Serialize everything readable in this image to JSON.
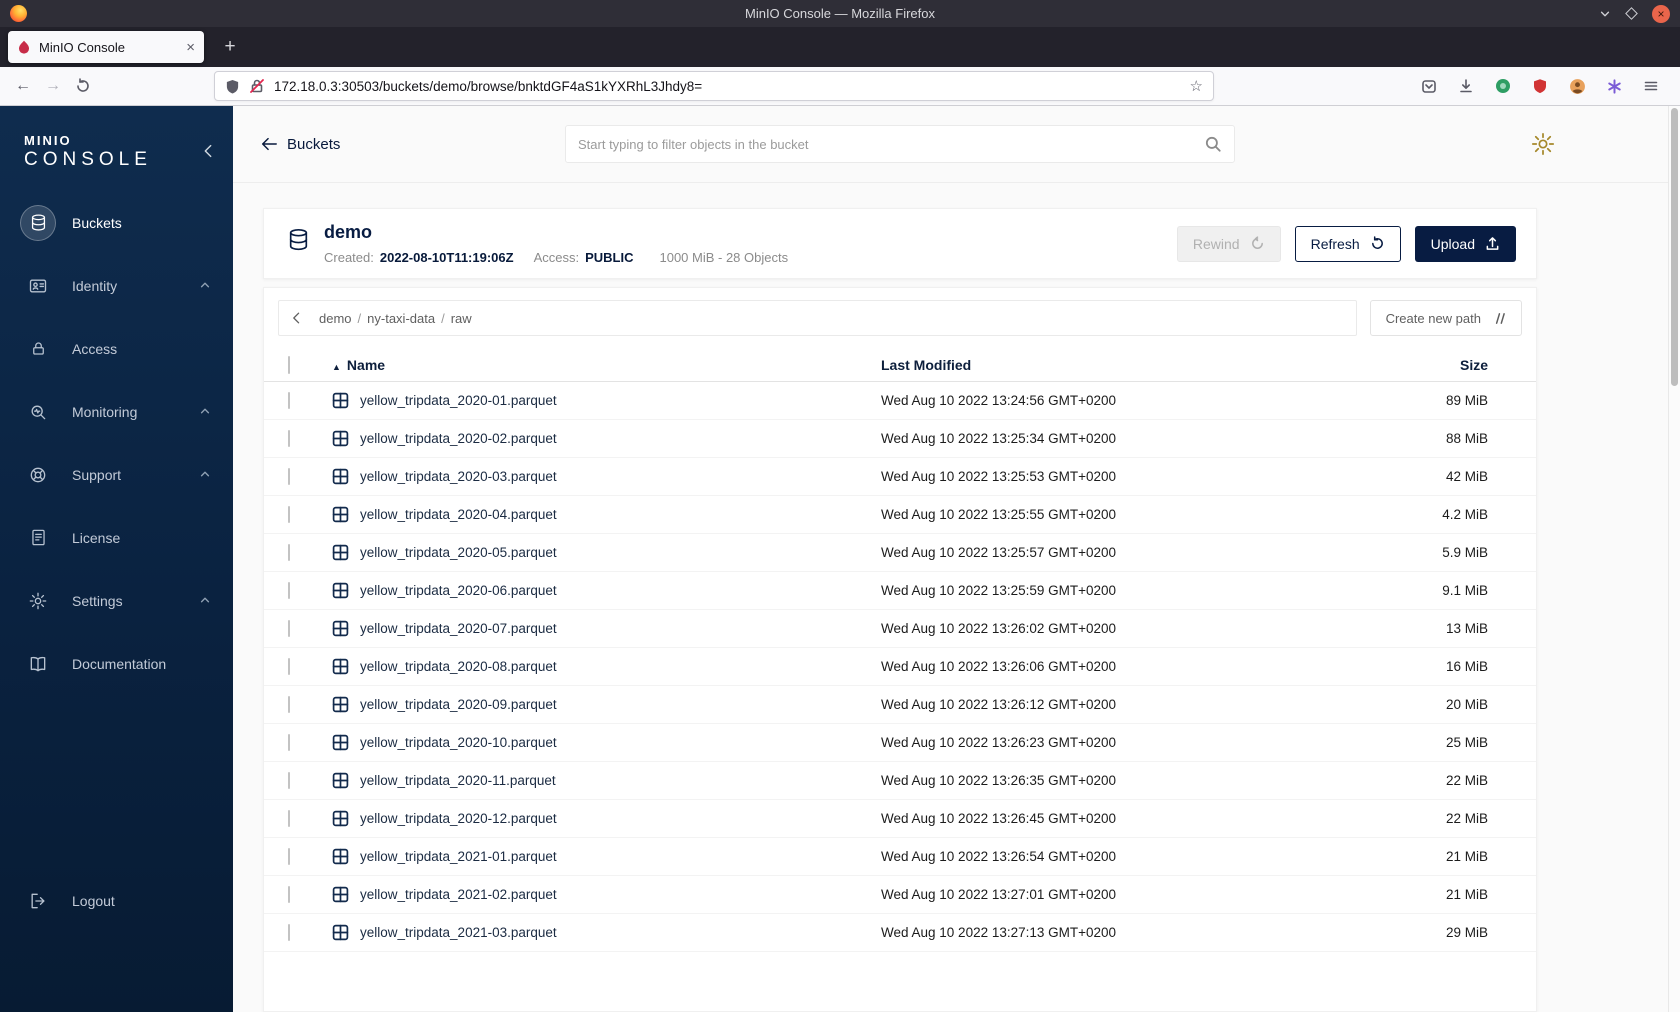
{
  "colors": {
    "brand_navy": "#081c42",
    "sidebar_top": "#0f2c4e",
    "sidebar_bottom": "#071b33",
    "settings_icon_gold": "#a5882a",
    "insecure_red": "#e22850"
  },
  "glyphs": {
    "tab_close": "×",
    "new_tab": "+",
    "nav_back": "←",
    "nav_forward": "→",
    "bookmark_star": "☆",
    "sort_asc": "▲",
    "window_close": "×"
  },
  "browser": {
    "window_title": "MinIO Console — Mozilla Firefox",
    "tab_title": "MinIO Console",
    "url": "172.18.0.3:30503/buckets/demo/browse/bnktdGF4aS1kYXRhL3Jhdy8="
  },
  "sidebar": {
    "brand_top": "MINIO",
    "brand_bottom": "CONSOLE",
    "items": [
      {
        "label": "Buckets",
        "active": true
      },
      {
        "label": "Identity",
        "expandable": true
      },
      {
        "label": "Access"
      },
      {
        "label": "Monitoring",
        "expandable": true
      },
      {
        "label": "Support",
        "expandable": true
      },
      {
        "label": "License"
      },
      {
        "label": "Settings",
        "expandable": true
      },
      {
        "label": "Documentation"
      }
    ],
    "logout_label": "Logout"
  },
  "topbar": {
    "back_label": "Buckets",
    "search_placeholder": "Start typing to filter objects in the bucket"
  },
  "bucket": {
    "name": "demo",
    "created_label": "Created:",
    "created_value": "2022-08-10T11:19:06Z",
    "access_label": "Access:",
    "access_value": "PUBLIC",
    "usage": "1000 MiB - 28 Objects",
    "rewind_label": "Rewind",
    "refresh_label": "Refresh",
    "upload_label": "Upload"
  },
  "browse": {
    "breadcrumb": [
      "demo",
      "ny-taxi-data",
      "raw"
    ],
    "separator": "/",
    "create_path_label": "Create new path"
  },
  "table": {
    "columns": {
      "name": "Name",
      "modified": "Last Modified",
      "size": "Size"
    },
    "rows": [
      {
        "name": "yellow_tripdata_2020-01.parquet",
        "modified": "Wed Aug 10 2022 13:24:56 GMT+0200",
        "size": "89 MiB"
      },
      {
        "name": "yellow_tripdata_2020-02.parquet",
        "modified": "Wed Aug 10 2022 13:25:34 GMT+0200",
        "size": "88 MiB"
      },
      {
        "name": "yellow_tripdata_2020-03.parquet",
        "modified": "Wed Aug 10 2022 13:25:53 GMT+0200",
        "size": "42 MiB"
      },
      {
        "name": "yellow_tripdata_2020-04.parquet",
        "modified": "Wed Aug 10 2022 13:25:55 GMT+0200",
        "size": "4.2 MiB"
      },
      {
        "name": "yellow_tripdata_2020-05.parquet",
        "modified": "Wed Aug 10 2022 13:25:57 GMT+0200",
        "size": "5.9 MiB"
      },
      {
        "name": "yellow_tripdata_2020-06.parquet",
        "modified": "Wed Aug 10 2022 13:25:59 GMT+0200",
        "size": "9.1 MiB"
      },
      {
        "name": "yellow_tripdata_2020-07.parquet",
        "modified": "Wed Aug 10 2022 13:26:02 GMT+0200",
        "size": "13 MiB"
      },
      {
        "name": "yellow_tripdata_2020-08.parquet",
        "modified": "Wed Aug 10 2022 13:26:06 GMT+0200",
        "size": "16 MiB"
      },
      {
        "name": "yellow_tripdata_2020-09.parquet",
        "modified": "Wed Aug 10 2022 13:26:12 GMT+0200",
        "size": "20 MiB"
      },
      {
        "name": "yellow_tripdata_2020-10.parquet",
        "modified": "Wed Aug 10 2022 13:26:23 GMT+0200",
        "size": "25 MiB"
      },
      {
        "name": "yellow_tripdata_2020-11.parquet",
        "modified": "Wed Aug 10 2022 13:26:35 GMT+0200",
        "size": "22 MiB"
      },
      {
        "name": "yellow_tripdata_2020-12.parquet",
        "modified": "Wed Aug 10 2022 13:26:45 GMT+0200",
        "size": "22 MiB"
      },
      {
        "name": "yellow_tripdata_2021-01.parquet",
        "modified": "Wed Aug 10 2022 13:26:54 GMT+0200",
        "size": "21 MiB"
      },
      {
        "name": "yellow_tripdata_2021-02.parquet",
        "modified": "Wed Aug 10 2022 13:27:01 GMT+0200",
        "size": "21 MiB"
      },
      {
        "name": "yellow_tripdata_2021-03.parquet",
        "modified": "Wed Aug 10 2022 13:27:13 GMT+0200",
        "size": "29 MiB"
      }
    ]
  }
}
